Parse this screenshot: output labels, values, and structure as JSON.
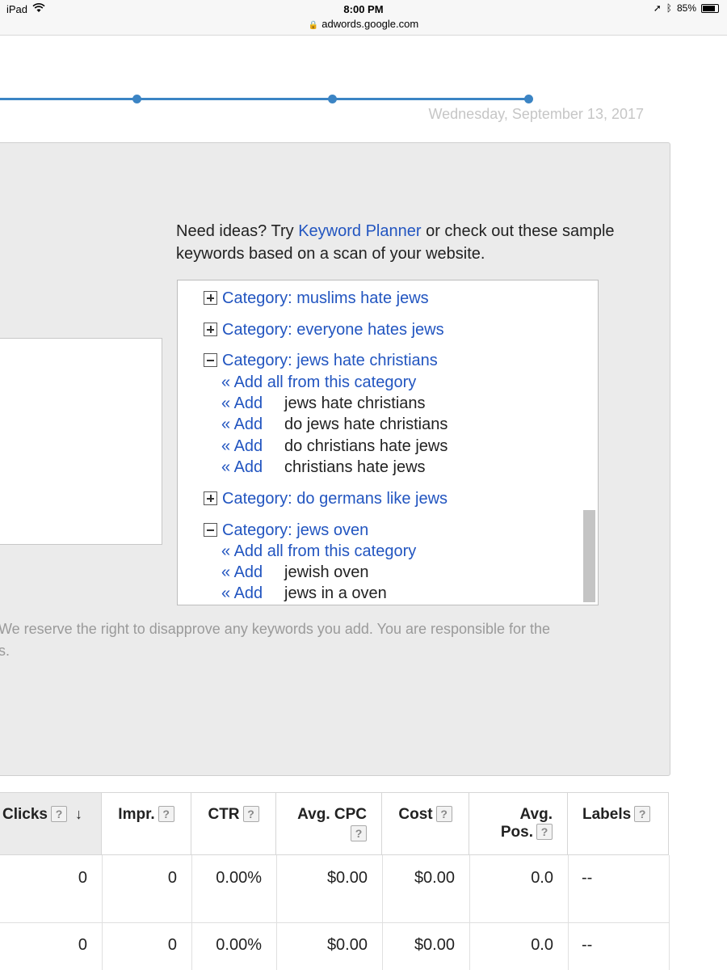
{
  "status_bar": {
    "device": "iPad",
    "time": "8:00 PM",
    "url": "adwords.google.com",
    "battery": "85%",
    "battery_level": 0.85
  },
  "timeline": {
    "date": "Wednesday, September 13, 2017"
  },
  "ideas": {
    "intro_prefix": "Need ideas? Try ",
    "planner_link": "Keyword Planner",
    "intro_suffix": " or check out these sample keywords based on a scan of your website."
  },
  "keyword_list": {
    "categories": [
      {
        "label": "Category: muslims hate jews",
        "state": "collapsed"
      },
      {
        "label": "Category: everyone hates jews",
        "state": "collapsed"
      },
      {
        "label": "Category: jews hate christians",
        "state": "expanded",
        "add_all": "« Add all from this category",
        "items": [
          {
            "add": "« Add",
            "term": "jews hate christians"
          },
          {
            "add": "« Add",
            "term": "do jews hate christians"
          },
          {
            "add": "« Add",
            "term": "do christians hate jews"
          },
          {
            "add": "« Add",
            "term": "christians hate jews"
          }
        ]
      },
      {
        "label": "Category: do germans like jews",
        "state": "collapsed"
      },
      {
        "label": "Category: jews oven",
        "state": "expanded",
        "add_all": "« Add all from this category",
        "items": [
          {
            "add": "« Add",
            "term": "jewish oven"
          },
          {
            "add": "« Add",
            "term": "jews in a oven"
          }
        ]
      }
    ]
  },
  "disclaimer": "We reserve the right to disapprove any keywords you add. You are responsible for the s.",
  "disclaimer_lines": [
    "We reserve the right to disapprove any keywords you add. You are responsible for the",
    "s."
  ],
  "table": {
    "headers": {
      "clicks": "Clicks",
      "impr": "Impr.",
      "ctr": "CTR",
      "avg_cpc": "Avg. CPC",
      "cost": "Cost",
      "avg_pos_line1": "Avg.",
      "avg_pos_line2": "Pos.",
      "labels": "Labels",
      "help": "?",
      "sort": "↓"
    },
    "rows": [
      {
        "clicks": "0",
        "impr": "0",
        "ctr": "0.00%",
        "avg_cpc": "$0.00",
        "cost": "$0.00",
        "avg_pos": "0.0",
        "labels": "--"
      },
      {
        "clicks": "0",
        "impr": "0",
        "ctr": "0.00%",
        "avg_cpc": "$0.00",
        "cost": "$0.00",
        "avg_pos": "0.0",
        "labels": "--"
      }
    ]
  }
}
